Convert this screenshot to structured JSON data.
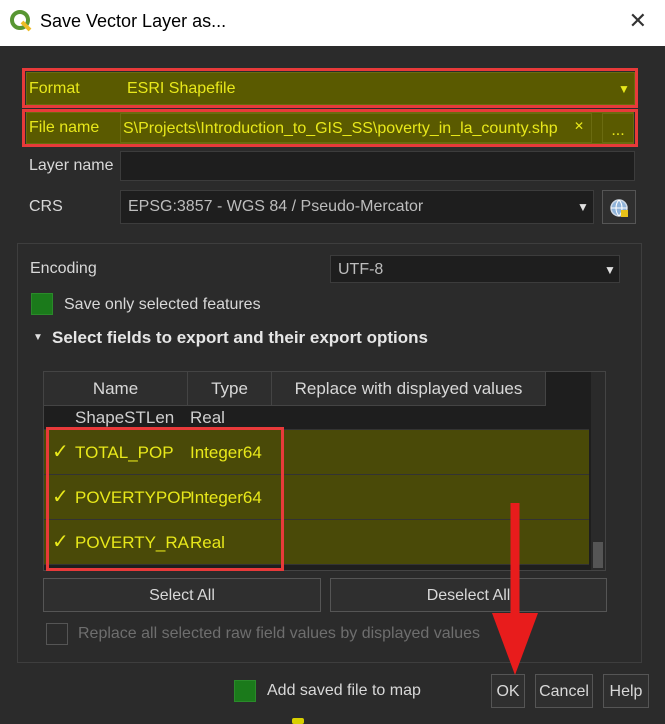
{
  "window": {
    "title": "Save Vector Layer as...",
    "close_glyph": "✕"
  },
  "format": {
    "label": "Format",
    "value": "ESRI Shapefile"
  },
  "file_name": {
    "label": "File name",
    "value": "S\\Projects\\Introduction_to_GIS_SS\\poverty_in_la_county.shp",
    "clear_glyph": "✕",
    "browse_label": "..."
  },
  "layer_name": {
    "label": "Layer name",
    "value": ""
  },
  "crs": {
    "label": "CRS",
    "value": "EPSG:3857 - WGS 84 / Pseudo-Mercator"
  },
  "encoding": {
    "label": "Encoding",
    "value": "UTF-8"
  },
  "save_selected": {
    "label": "Save only selected features",
    "checked": false
  },
  "fields_section": {
    "title": "Select fields to export and their export options",
    "columns": [
      "Name",
      "Type",
      "Replace with displayed values"
    ],
    "rows": [
      {
        "name": "ShapeSTLen",
        "type": "Real",
        "checked": false,
        "highlight": false
      },
      {
        "name": "TOTAL_POP",
        "type": "Integer64",
        "checked": true,
        "highlight": true
      },
      {
        "name": "POVERTYPOP",
        "type": "Integer64",
        "checked": true,
        "highlight": true
      },
      {
        "name": "POVERTY_RA",
        "type": "Real",
        "checked": true,
        "highlight": true
      }
    ],
    "select_all": "Select All",
    "deselect_all": "Deselect All",
    "replace_label": "Replace all selected raw field values by displayed values"
  },
  "add_to_map": {
    "label": "Add saved file to map",
    "checked": true
  },
  "buttons": {
    "ok": "OK",
    "cancel": "Cancel",
    "help": "Help"
  },
  "colors": {
    "highlight_bg": "#5a5a00",
    "highlight_text": "#e8e81a",
    "annotation_red": "#e83a3a",
    "check_green": "#1b7a1b"
  }
}
